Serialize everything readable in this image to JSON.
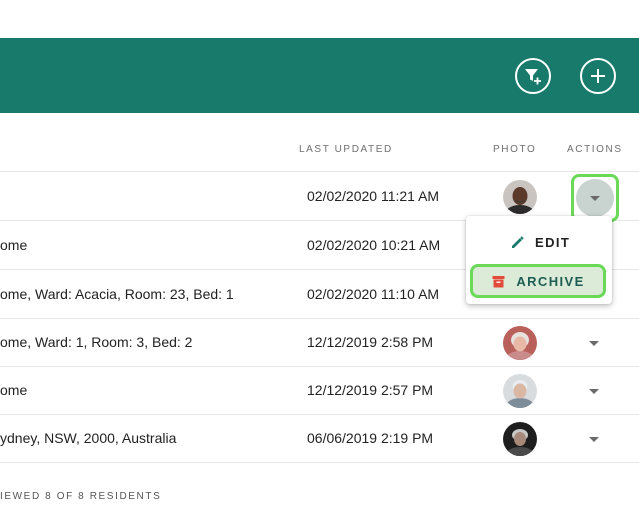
{
  "toolbar": {
    "filter_icon": "filter-add-icon",
    "add_icon": "plus-icon",
    "bar_color": "#177a6b"
  },
  "table": {
    "headers": {
      "last_updated": "LAST UPDATED",
      "photo": "PHOTO",
      "actions": "ACTIONS"
    },
    "rows": [
      {
        "location": "",
        "last_updated": "02/02/2020 11:21 AM"
      },
      {
        "location": "ome",
        "last_updated": "02/02/2020 10:21 AM"
      },
      {
        "location": "ome, Ward: Acacia, Room: 23, Bed: 1",
        "last_updated": "02/02/2020 11:10 AM"
      },
      {
        "location": "ome, Ward: 1, Room: 3, Bed: 2",
        "last_updated": "12/12/2019 2:58 PM"
      },
      {
        "location": "ome",
        "last_updated": "12/12/2019 2:57 PM"
      },
      {
        "location": "ydney, NSW, 2000, Australia",
        "last_updated": "06/06/2019 2:19 PM"
      }
    ]
  },
  "actions_menu": {
    "edit_label": "EDIT",
    "archive_label": "ARCHIVE",
    "edit_icon": "pencil-icon",
    "archive_icon": "archive-box-icon"
  },
  "footer": {
    "text": "IEWED 8 OF 8 RESIDENTS"
  }
}
